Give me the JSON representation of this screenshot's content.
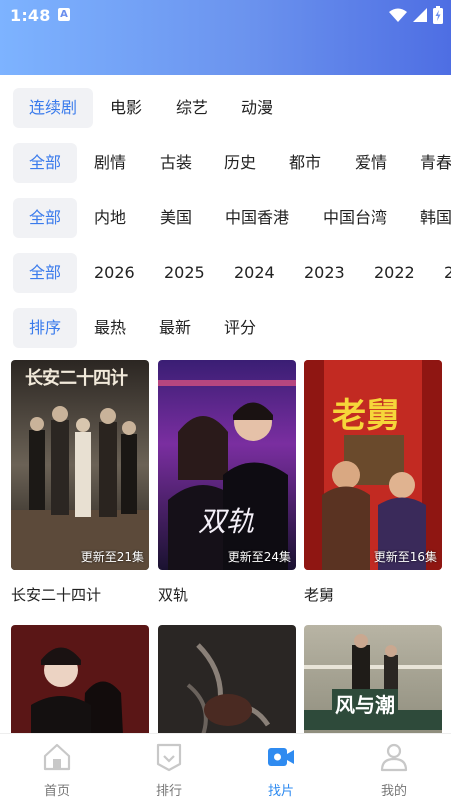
{
  "status": {
    "time": "1:48",
    "app_badge": "A"
  },
  "filters": {
    "category": {
      "selected": "连续剧",
      "options": [
        "电影",
        "综艺",
        "动漫"
      ]
    },
    "genre": {
      "selected": "全部",
      "options": [
        "剧情",
        "古装",
        "历史",
        "都市",
        "爱情",
        "青春"
      ]
    },
    "region": {
      "selected": "全部",
      "options": [
        "内地",
        "美国",
        "中国香港",
        "中国台湾",
        "韩国"
      ]
    },
    "year": {
      "selected": "全部",
      "options": [
        "2026",
        "2025",
        "2024",
        "2023",
        "2022",
        "2"
      ]
    },
    "sort": {
      "selected": "排序",
      "options": [
        "最热",
        "最新",
        "评分"
      ]
    }
  },
  "cards": [
    {
      "title": "长安二十四计",
      "badge": "更新至21集",
      "poster_text": "长安二十四计"
    },
    {
      "title": "双轨",
      "badge": "更新至24集",
      "poster_text": "双轨"
    },
    {
      "title": "老舅",
      "badge": "更新至16集",
      "poster_text": "老舅"
    },
    {
      "title": "",
      "badge": "",
      "poster_text": ""
    },
    {
      "title": "",
      "badge": "",
      "poster_text": ""
    },
    {
      "title": "",
      "badge": "",
      "poster_text": "风与潮"
    }
  ],
  "nav": {
    "items": [
      {
        "label": "首页",
        "icon": "home-icon"
      },
      {
        "label": "排行",
        "icon": "ranking-icon"
      },
      {
        "label": "找片",
        "icon": "video-search-icon"
      },
      {
        "label": "我的",
        "icon": "profile-icon"
      }
    ],
    "active": "找片",
    "active_color": "#2f8bf0"
  },
  "colors": {
    "accent": "#3a7bec",
    "chip_bg": "#f1f2f5"
  }
}
